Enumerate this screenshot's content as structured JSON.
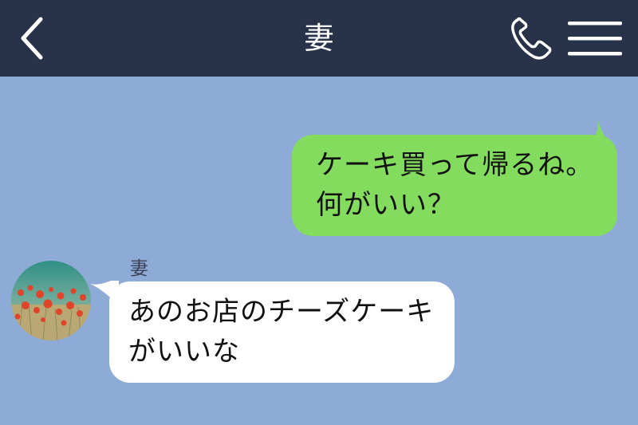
{
  "header": {
    "title": "妻"
  },
  "messages": {
    "outgoing": {
      "lines": [
        "ケーキ買って帰るね。",
        "何がいい？"
      ]
    },
    "incoming": {
      "sender": "妻",
      "lines": [
        "あのお店のチーズケーキ",
        "がいいな"
      ]
    }
  },
  "colors": {
    "header_bg": "#283248",
    "chat_bg": "#8eaad7",
    "outgoing_bubble": "#84dc5f",
    "incoming_bubble": "#ffffff"
  },
  "icons": {
    "back": "chevron-left-icon",
    "call": "phone-icon",
    "menu": "hamburger-menu-icon",
    "avatar": "poppy-field-photo"
  }
}
